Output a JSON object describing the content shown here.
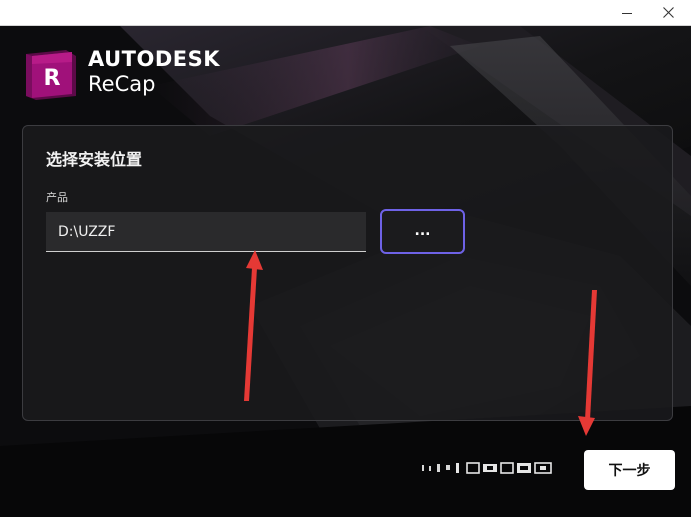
{
  "window": {
    "minimize_icon": "minimize-icon",
    "close_icon": "close-icon"
  },
  "header": {
    "logo_letter": "R",
    "brand": "AUTODESK",
    "product": "ReCap"
  },
  "panel": {
    "title": "选择安装位置",
    "field_label": "产品",
    "path_value": "D:\\UZZF",
    "browse_label": "..."
  },
  "footer": {
    "next_label": "下一步"
  },
  "colors": {
    "accent_border": "#6e62e6",
    "logo_magenta": "#a0117a",
    "annotation_red": "#e53935"
  }
}
